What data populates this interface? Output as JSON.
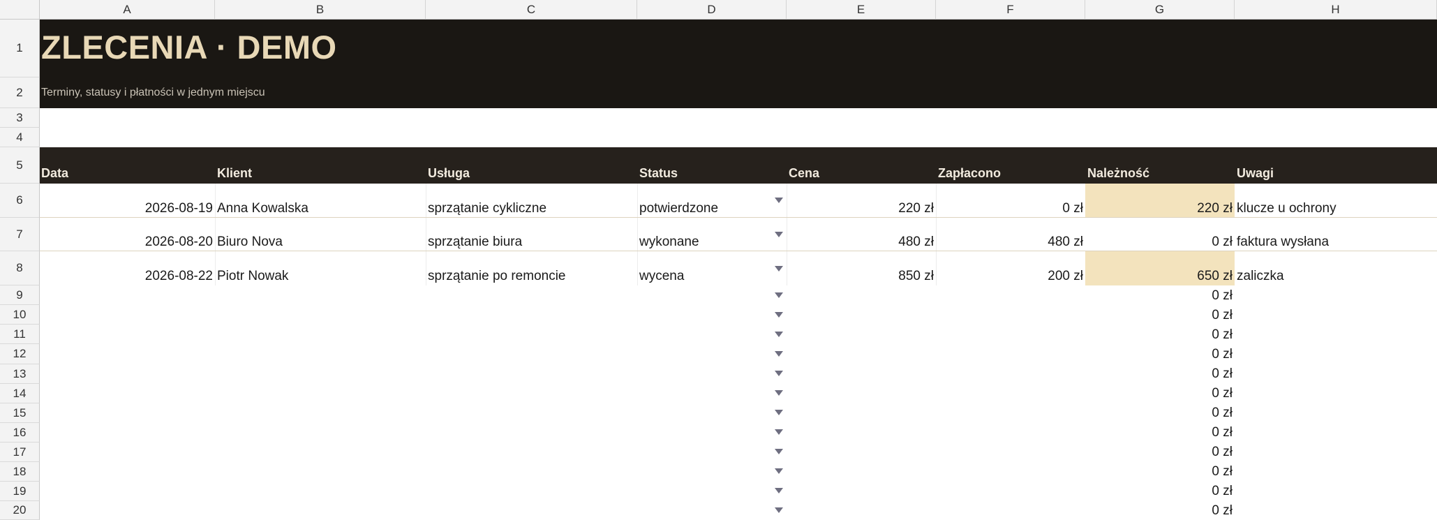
{
  "columns": [
    "A",
    "B",
    "C",
    "D",
    "E",
    "F",
    "G",
    "H"
  ],
  "row_numbers": [
    "1",
    "2",
    "3",
    "4",
    "5",
    "6",
    "7",
    "8",
    "9",
    "10",
    "11",
    "12",
    "13",
    "14",
    "15",
    "16",
    "17",
    "18",
    "19",
    "20"
  ],
  "title": "ZLECENIA · DEMO",
  "subtitle": "Terminy, statusy i płatności w jednym miejscu",
  "headers": {
    "date": "Data",
    "client": "Klient",
    "service": "Usługa",
    "status": "Status",
    "price": "Cena",
    "paid": "Zapłacono",
    "due": "Należność",
    "notes": "Uwagi"
  },
  "rows": [
    {
      "date": "2026-08-19",
      "client": "Anna Kowalska",
      "service": "sprzątanie cykliczne",
      "status": "potwierdzone",
      "price": "220 zł",
      "paid": "0 zł",
      "due": "220 zł",
      "notes": "klucze u ochrony"
    },
    {
      "date": "2026-08-20",
      "client": "Biuro Nova",
      "service": "sprzątanie biura",
      "status": "wykonane",
      "price": "480 zł",
      "paid": "480 zł",
      "due": "0 zł",
      "notes": "faktura wysłana"
    },
    {
      "date": "2026-08-22",
      "client": "Piotr Nowak",
      "service": "sprzątanie po remoncie",
      "status": "wycena",
      "price": "850 zł",
      "paid": "200 zł",
      "due": "650 zł",
      "notes": "zaliczka"
    }
  ],
  "empty_due": [
    "0 zł",
    "0 zł",
    "0 zł",
    "0 zł",
    "0 zł",
    "0 zł",
    "0 zł",
    "0 zł",
    "0 zł",
    "0 zł",
    "0 zł",
    "0 zł"
  ],
  "colors": {
    "title_bg": "#1a1713",
    "title_text": "#e8d8b6",
    "header_bg": "#26211c",
    "due_highlight": "#f3e3bd",
    "dropdown_arrow": "#6e6e80"
  },
  "icons": {
    "status_dropdown": "triangle-down-icon"
  }
}
